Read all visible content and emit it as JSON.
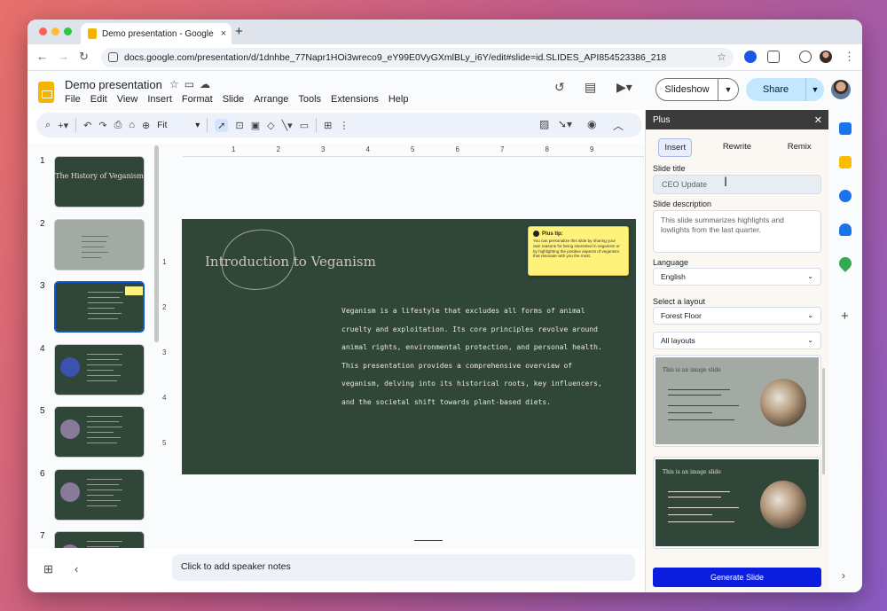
{
  "browser": {
    "tab_title": "Demo presentation - Google S",
    "tab_close": "×",
    "new_tab": "+",
    "url": "docs.google.com/presentation/d/1dnhbe_77Napr1HOi3wreco9_eY99E0VyGXmlBLy_i6Y/edit#slide=id.SLIDES_API854523386_218",
    "nav": {
      "back": "←",
      "forward": "→",
      "reload": "↻"
    },
    "star": "☆",
    "menu": "⋮"
  },
  "docs": {
    "title": "Demo presentation",
    "title_icons": [
      "star-icon",
      "move-to-folder-icon",
      "cloud-status-icon"
    ],
    "menus": [
      "File",
      "Edit",
      "View",
      "Insert",
      "Format",
      "Slide",
      "Arrange",
      "Tools",
      "Extensions",
      "Help"
    ],
    "slideshow_label": "Slideshow",
    "share_label": "Share",
    "history_icon": "history-icon",
    "comments_icon": "comments-icon",
    "meet_icon": "meet-icon"
  },
  "toolbar": {
    "zoom_label": "Fit",
    "items": [
      "search-icon",
      "add-icon",
      "undo-icon",
      "redo-icon",
      "print-icon",
      "paint-format-icon",
      "zoom-icon",
      "select-icon",
      "text-box-icon",
      "image-icon",
      "shape-icon",
      "line-icon",
      "video-icon",
      "comment-icon",
      "more-icon"
    ]
  },
  "filmstrip": {
    "slides": [
      {
        "num": "1",
        "kind": "dark",
        "title": "The History of Veganism",
        "selected": false
      },
      {
        "num": "2",
        "kind": "gray",
        "title": "Agenda",
        "selected": false
      },
      {
        "num": "3",
        "kind": "dark",
        "title": "Introduction to Veganism",
        "selected": true
      },
      {
        "num": "4",
        "kind": "dark",
        "title": "",
        "selected": false
      },
      {
        "num": "5",
        "kind": "dark",
        "title": "",
        "selected": false
      },
      {
        "num": "6",
        "kind": "dark",
        "title": "",
        "selected": false
      },
      {
        "num": "7",
        "kind": "dark",
        "title": "",
        "selected": false
      }
    ]
  },
  "ruler": {
    "h": [
      "1",
      "2",
      "3",
      "4",
      "5",
      "6",
      "7",
      "8",
      "9"
    ],
    "v": [
      "1",
      "2",
      "3",
      "4",
      "5"
    ]
  },
  "slide": {
    "title": "Introduction to Veganism",
    "body": "Veganism is a lifestyle that excludes all forms of animal cruelty and exploitation. Its core principles revolve around animal rights, environmental protection, and personal health. This presentation provides a comprehensive overview of veganism, delving into its historical roots, key influencers, and the societal shift towards plant-based diets.",
    "tip_title": "Plus tip:",
    "tip_body": "You can personalize this slide by sharing your own reasons for being interested in veganism or by highlighting the positive aspects of veganism that resonate with you the most."
  },
  "notes": {
    "placeholder": "Click to add speaker notes"
  },
  "panel": {
    "title": "Plus",
    "tabs": [
      "Insert",
      "Rewrite",
      "Remix"
    ],
    "active_tab": "Insert",
    "slide_title_label": "Slide title",
    "slide_title_value": "CEO Update",
    "slide_desc_label": "Slide description",
    "slide_desc_value": "This slide summarizes highlights and lowlights from the last quarter.",
    "language_label": "Language",
    "language_value": "English",
    "layout_label": "Select a layout",
    "layout_theme": "Forest Floor",
    "layout_filter": "All layouts",
    "layout_cards": [
      {
        "title": "This is an image slide",
        "bg": "#a3a9a3",
        "fg": "#2f4639"
      },
      {
        "title": "This is an image slide",
        "bg": "#2f4639",
        "fg": "#e7e1d6"
      }
    ],
    "generate_label": "Generate Slide"
  },
  "colors": {
    "slide_bg": "#2f4639",
    "accent_blue": "#0b1edf",
    "share_bg": "#c2e7ff",
    "tip_bg": "#fff27a"
  }
}
